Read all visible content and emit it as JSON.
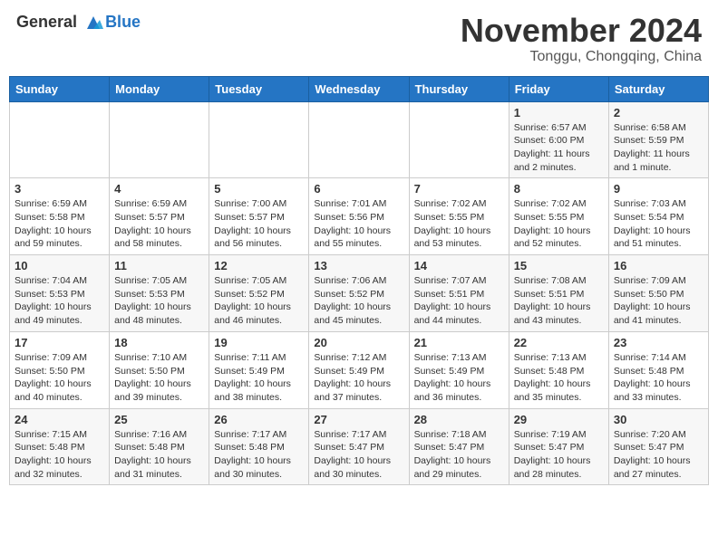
{
  "header": {
    "logo_line1": "General",
    "logo_line2": "Blue",
    "month": "November 2024",
    "location": "Tonggu, Chongqing, China"
  },
  "weekdays": [
    "Sunday",
    "Monday",
    "Tuesday",
    "Wednesday",
    "Thursday",
    "Friday",
    "Saturday"
  ],
  "weeks": [
    [
      {
        "day": "",
        "info": ""
      },
      {
        "day": "",
        "info": ""
      },
      {
        "day": "",
        "info": ""
      },
      {
        "day": "",
        "info": ""
      },
      {
        "day": "",
        "info": ""
      },
      {
        "day": "1",
        "info": "Sunrise: 6:57 AM\nSunset: 6:00 PM\nDaylight: 11 hours\nand 2 minutes."
      },
      {
        "day": "2",
        "info": "Sunrise: 6:58 AM\nSunset: 5:59 PM\nDaylight: 11 hours\nand 1 minute."
      }
    ],
    [
      {
        "day": "3",
        "info": "Sunrise: 6:59 AM\nSunset: 5:58 PM\nDaylight: 10 hours\nand 59 minutes."
      },
      {
        "day": "4",
        "info": "Sunrise: 6:59 AM\nSunset: 5:57 PM\nDaylight: 10 hours\nand 58 minutes."
      },
      {
        "day": "5",
        "info": "Sunrise: 7:00 AM\nSunset: 5:57 PM\nDaylight: 10 hours\nand 56 minutes."
      },
      {
        "day": "6",
        "info": "Sunrise: 7:01 AM\nSunset: 5:56 PM\nDaylight: 10 hours\nand 55 minutes."
      },
      {
        "day": "7",
        "info": "Sunrise: 7:02 AM\nSunset: 5:55 PM\nDaylight: 10 hours\nand 53 minutes."
      },
      {
        "day": "8",
        "info": "Sunrise: 7:02 AM\nSunset: 5:55 PM\nDaylight: 10 hours\nand 52 minutes."
      },
      {
        "day": "9",
        "info": "Sunrise: 7:03 AM\nSunset: 5:54 PM\nDaylight: 10 hours\nand 51 minutes."
      }
    ],
    [
      {
        "day": "10",
        "info": "Sunrise: 7:04 AM\nSunset: 5:53 PM\nDaylight: 10 hours\nand 49 minutes."
      },
      {
        "day": "11",
        "info": "Sunrise: 7:05 AM\nSunset: 5:53 PM\nDaylight: 10 hours\nand 48 minutes."
      },
      {
        "day": "12",
        "info": "Sunrise: 7:05 AM\nSunset: 5:52 PM\nDaylight: 10 hours\nand 46 minutes."
      },
      {
        "day": "13",
        "info": "Sunrise: 7:06 AM\nSunset: 5:52 PM\nDaylight: 10 hours\nand 45 minutes."
      },
      {
        "day": "14",
        "info": "Sunrise: 7:07 AM\nSunset: 5:51 PM\nDaylight: 10 hours\nand 44 minutes."
      },
      {
        "day": "15",
        "info": "Sunrise: 7:08 AM\nSunset: 5:51 PM\nDaylight: 10 hours\nand 43 minutes."
      },
      {
        "day": "16",
        "info": "Sunrise: 7:09 AM\nSunset: 5:50 PM\nDaylight: 10 hours\nand 41 minutes."
      }
    ],
    [
      {
        "day": "17",
        "info": "Sunrise: 7:09 AM\nSunset: 5:50 PM\nDaylight: 10 hours\nand 40 minutes."
      },
      {
        "day": "18",
        "info": "Sunrise: 7:10 AM\nSunset: 5:50 PM\nDaylight: 10 hours\nand 39 minutes."
      },
      {
        "day": "19",
        "info": "Sunrise: 7:11 AM\nSunset: 5:49 PM\nDaylight: 10 hours\nand 38 minutes."
      },
      {
        "day": "20",
        "info": "Sunrise: 7:12 AM\nSunset: 5:49 PM\nDaylight: 10 hours\nand 37 minutes."
      },
      {
        "day": "21",
        "info": "Sunrise: 7:13 AM\nSunset: 5:49 PM\nDaylight: 10 hours\nand 36 minutes."
      },
      {
        "day": "22",
        "info": "Sunrise: 7:13 AM\nSunset: 5:48 PM\nDaylight: 10 hours\nand 35 minutes."
      },
      {
        "day": "23",
        "info": "Sunrise: 7:14 AM\nSunset: 5:48 PM\nDaylight: 10 hours\nand 33 minutes."
      }
    ],
    [
      {
        "day": "24",
        "info": "Sunrise: 7:15 AM\nSunset: 5:48 PM\nDaylight: 10 hours\nand 32 minutes."
      },
      {
        "day": "25",
        "info": "Sunrise: 7:16 AM\nSunset: 5:48 PM\nDaylight: 10 hours\nand 31 minutes."
      },
      {
        "day": "26",
        "info": "Sunrise: 7:17 AM\nSunset: 5:48 PM\nDaylight: 10 hours\nand 30 minutes."
      },
      {
        "day": "27",
        "info": "Sunrise: 7:17 AM\nSunset: 5:47 PM\nDaylight: 10 hours\nand 30 minutes."
      },
      {
        "day": "28",
        "info": "Sunrise: 7:18 AM\nSunset: 5:47 PM\nDaylight: 10 hours\nand 29 minutes."
      },
      {
        "day": "29",
        "info": "Sunrise: 7:19 AM\nSunset: 5:47 PM\nDaylight: 10 hours\nand 28 minutes."
      },
      {
        "day": "30",
        "info": "Sunrise: 7:20 AM\nSunset: 5:47 PM\nDaylight: 10 hours\nand 27 minutes."
      }
    ]
  ]
}
